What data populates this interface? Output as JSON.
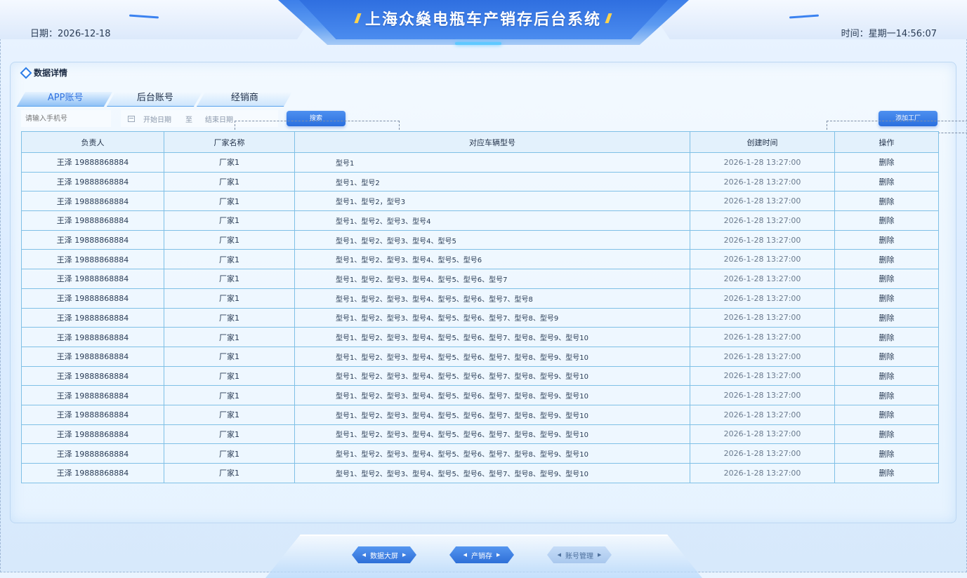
{
  "header": {
    "title": "上海众燊电瓶车产销存后台系统",
    "date_label": "日期：2026-12-18",
    "time_label": "时间：星期一14:56:07"
  },
  "panel": {
    "title": "数据详情"
  },
  "tabs": [
    {
      "label": "APP账号",
      "active": true
    },
    {
      "label": "后台账号",
      "active": false
    },
    {
      "label": "经销商",
      "active": false
    }
  ],
  "filters": {
    "phone_placeholder": "请输入手机号",
    "start_date": "开始日期",
    "separator": "至",
    "end_date": "结束日期",
    "search_label": "搜索",
    "add_label": "添加工厂"
  },
  "table": {
    "headers": [
      "负责人",
      "厂家名称",
      "对应车辆型号",
      "创建时间",
      "操作"
    ],
    "rows": [
      [
        "王泽 19888868884",
        "厂家1",
        "型号1",
        "2026-1-28  13:27:00",
        "删除"
      ],
      [
        "王泽 19888868884",
        "厂家1",
        "型号1、型号2",
        "2026-1-28  13:27:00",
        "删除"
      ],
      [
        "王泽 19888868884",
        "厂家1",
        "型号1、型号2，型号3",
        "2026-1-28  13:27:00",
        "删除"
      ],
      [
        "王泽 19888868884",
        "厂家1",
        "型号1、型号2、型号3、型号4",
        "2026-1-28  13:27:00",
        "删除"
      ],
      [
        "王泽 19888868884",
        "厂家1",
        "型号1、型号2、型号3、型号4、型号5",
        "2026-1-28  13:27:00",
        "删除"
      ],
      [
        "王泽 19888868884",
        "厂家1",
        "型号1、型号2、型号3、型号4、型号5、型号6",
        "2026-1-28  13:27:00",
        "删除"
      ],
      [
        "王泽 19888868884",
        "厂家1",
        "型号1、型号2、型号3、型号4、型号5、型号6、型号7",
        "2026-1-28  13:27:00",
        "删除"
      ],
      [
        "王泽 19888868884",
        "厂家1",
        "型号1、型号2、型号3、型号4、型号5、型号6、型号7、型号8",
        "2026-1-28  13:27:00",
        "删除"
      ],
      [
        "王泽 19888868884",
        "厂家1",
        "型号1、型号2、型号3、型号4、型号5、型号6、型号7、型号8、型号9",
        "2026-1-28  13:27:00",
        "删除"
      ],
      [
        "王泽 19888868884",
        "厂家1",
        "型号1、型号2、型号3、型号4、型号5、型号6、型号7、型号8、型号9、型号10",
        "2026-1-28  13:27:00",
        "删除"
      ],
      [
        "王泽 19888868884",
        "厂家1",
        "型号1、型号2、型号3、型号4、型号5、型号6、型号7、型号8、型号9、型号10",
        "2026-1-28  13:27:00",
        "删除"
      ],
      [
        "王泽 19888868884",
        "厂家1",
        "型号1、型号2、型号3、型号4、型号5、型号6、型号7、型号8、型号9、型号10",
        "2026-1-28  13:27:00",
        "删除"
      ],
      [
        "王泽 19888868884",
        "厂家1",
        "型号1、型号2、型号3、型号4、型号5、型号6、型号7、型号8、型号9、型号10",
        "2026-1-28  13:27:00",
        "删除"
      ],
      [
        "王泽 19888868884",
        "厂家1",
        "型号1、型号2、型号3、型号4、型号5、型号6、型号7、型号8、型号9、型号10",
        "2026-1-28  13:27:00",
        "删除"
      ],
      [
        "王泽 19888868884",
        "厂家1",
        "型号1、型号2、型号3、型号4、型号5、型号6、型号7、型号8、型号9、型号10",
        "2026-1-28  13:27:00",
        "删除"
      ],
      [
        "王泽 19888868884",
        "厂家1",
        "型号1、型号2、型号3、型号4、型号5、型号6、型号7、型号8、型号9、型号10",
        "2026-1-28  13:27:00",
        "删除"
      ],
      [
        "王泽 19888868884",
        "厂家1",
        "型号1、型号2、型号3、型号4、型号5、型号6、型号7、型号8、型号9、型号10",
        "2026-1-28  13:27:00",
        "删除"
      ]
    ]
  },
  "bottom_nav": [
    {
      "label": "数据大屏",
      "active": true
    },
    {
      "label": "产销存",
      "active": true
    },
    {
      "label": "账号管理",
      "active": false
    }
  ],
  "colors": {
    "accent": "#2f72e0",
    "title_mark": "#ffd34d",
    "table_border": "#7fc0e6"
  }
}
